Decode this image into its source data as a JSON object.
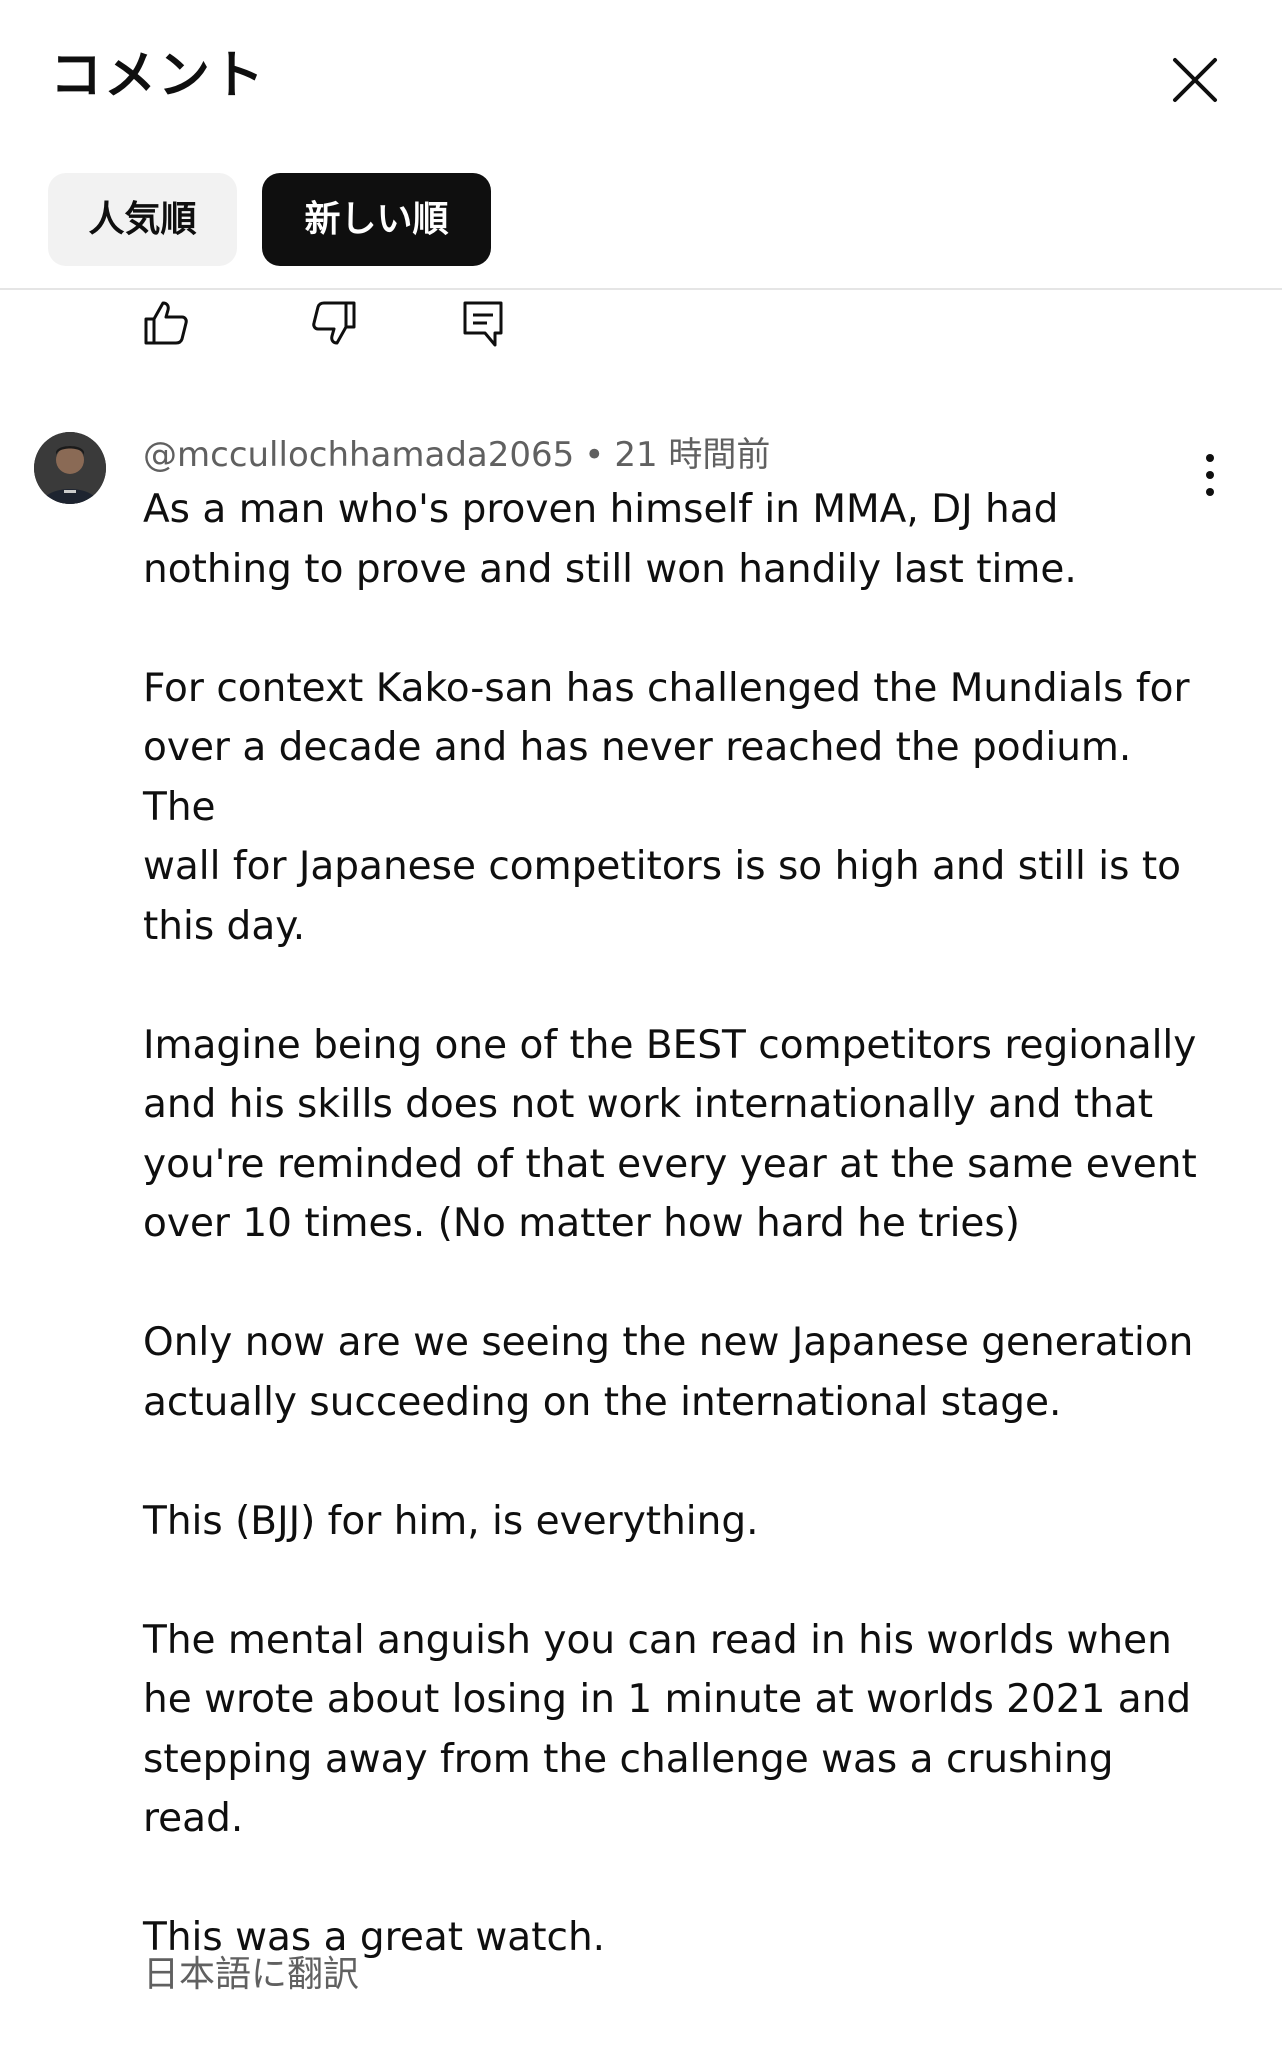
{
  "header": {
    "title": "コメント",
    "close_icon": "close-icon",
    "sort_chips": [
      {
        "label": "人気順",
        "selected": false
      },
      {
        "label": "新しい順",
        "selected": true
      }
    ]
  },
  "previous_comment_actions": {
    "icons": [
      "thumbs-up-icon",
      "thumbs-down-icon",
      "reply-icon"
    ]
  },
  "comment": {
    "author": "@mccullochhamada2065",
    "separator": "•",
    "time": "21 時間前",
    "paragraphs": [
      "As a man who's proven himself in MMA, DJ had\nnothing to prove and still won handily last time.",
      "For context Kako-san has challenged the Mundials for\nover a decade and has never reached the podium. The\nwall for Japanese competitors is so high and still is to\nthis day.",
      "Imagine being one of the BEST competitors regionally\nand his skills does not work internationally and that\nyou're reminded of that every year at the same event\nover 10 times. (No matter how hard he tries)",
      "Only now are we seeing the new Japanese generation\nactually succeeding on the international stage.",
      "This (BJJ) for him, is everything.",
      "The mental anguish you can read in his worlds when\nhe wrote about losing in 1 minute at worlds 2021 and\nstepping away from the challenge was a crushing\nread.",
      "This was a great watch."
    ],
    "translate_label": "日本語に翻訳",
    "more_icon": "more-vert-icon"
  },
  "colors": {
    "text_primary": "#0f0f0f",
    "text_secondary": "#606060",
    "chip_selected_bg": "#0f0f0f",
    "chip_unselected_bg": "#f2f2f2"
  }
}
